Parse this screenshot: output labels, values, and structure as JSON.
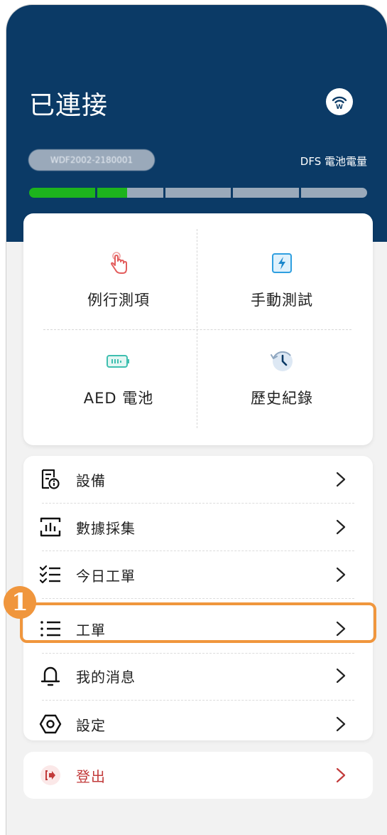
{
  "header": {
    "title": "已連接",
    "serial_number": "WDF2002-2180001",
    "battery_label": "DFS 電池電量",
    "battery_level": 0.29
  },
  "quick_actions": [
    {
      "label": "例行測項",
      "icon": "tap-hand-icon"
    },
    {
      "label": "手動測試",
      "icon": "lightning-card-icon"
    },
    {
      "label": "AED 電池",
      "icon": "battery-icon"
    },
    {
      "label": "歷史紀錄",
      "icon": "history-clock-icon"
    }
  ],
  "menu": [
    {
      "label": "設備",
      "icon": "device-info-icon"
    },
    {
      "label": "數據採集",
      "icon": "data-chart-icon"
    },
    {
      "label": "今日工單",
      "icon": "checklist-icon"
    },
    {
      "label": "工單",
      "icon": "list-icon"
    },
    {
      "label": "我的消息",
      "icon": "bell-icon"
    },
    {
      "label": "設定",
      "icon": "settings-hex-icon"
    }
  ],
  "logout": {
    "label": "登出",
    "icon": "logout-icon"
  },
  "annotation": {
    "step": "1"
  },
  "colors": {
    "header_bg": "#0b3a66",
    "battery_green": "#1db31d",
    "highlight": "#f0963d",
    "logout_red": "#c23b3b"
  }
}
